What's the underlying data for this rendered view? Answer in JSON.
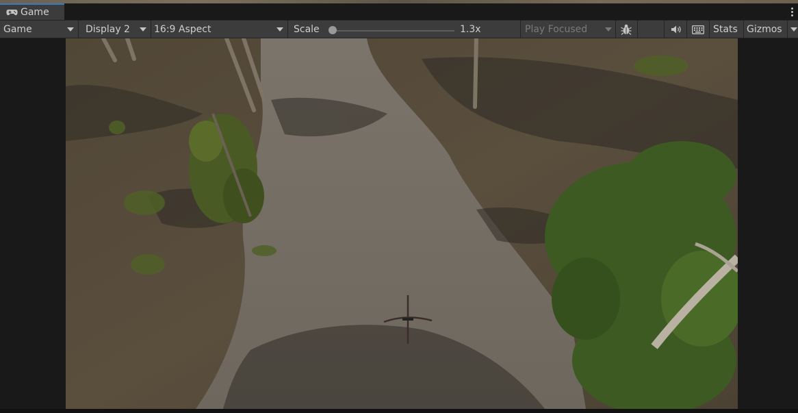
{
  "tab": {
    "label": "Game",
    "icon": "gamepad-icon"
  },
  "toolbar": {
    "view_mode": "Game",
    "display": "Display 2",
    "aspect": "16:9 Aspect",
    "scale_label": "Scale",
    "scale_value": "1.3x",
    "play_mode": "Play Focused",
    "stats_label": "Stats",
    "gizmos_label": "Gizmos",
    "icons": [
      "bug-icon",
      "speaker-icon",
      "keyboard-icon",
      "chevron-down-icon",
      "kebab-menu-icon"
    ]
  },
  "colors": {
    "tab_accent": "#3a79bb",
    "toolbar_bg": "#3c3c3c",
    "editor_bg": "#191919"
  }
}
